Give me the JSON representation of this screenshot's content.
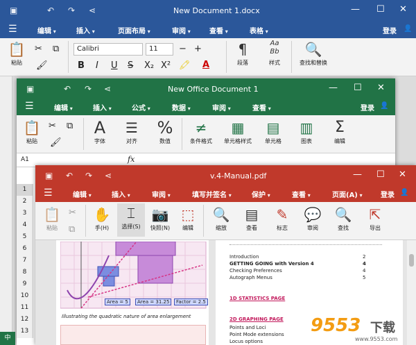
{
  "word": {
    "title": "New Document 1.docx",
    "menu": [
      "编辑",
      "插入",
      "页面布局",
      "审阅",
      "查看",
      "表格"
    ],
    "login": "登录",
    "ribbon": {
      "paste": "粘贴",
      "font": "Calibri",
      "size": "11",
      "minus": "−",
      "plus": "+",
      "bold": "B",
      "italic": "I",
      "underline": "U",
      "strike": "S",
      "sub": "X₂",
      "sup": "X²",
      "paragraph": "段落",
      "style_glyph": "Aa\nBb",
      "style": "样式",
      "find": "查找和替换"
    }
  },
  "excel": {
    "title": "New Office Document 1",
    "menu": [
      "编辑",
      "插入",
      "公式",
      "数据",
      "审阅",
      "查看"
    ],
    "login": "登录",
    "ribbon": [
      "粘贴",
      "字体",
      "对齐",
      "数值",
      "条件格式",
      "单元格样式",
      "单元格",
      "图表",
      "编辑"
    ],
    "cell_ref": "A1",
    "fx": "fx",
    "rows": [
      "1",
      "2",
      "3",
      "4",
      "5",
      "6",
      "7",
      "8",
      "9",
      "10",
      "11",
      "12",
      "13",
      "14",
      "15"
    ],
    "sheet_tab": "中"
  },
  "pdf": {
    "title": "v.4-Manual.pdf",
    "menu": [
      "编辑",
      "插入",
      "审阅",
      "填写并签名",
      "保护",
      "查看",
      "页面(A)"
    ],
    "login": "登录",
    "ribbon": [
      "粘贴",
      "",
      "手(H)",
      "选择(S)",
      "快照(N)",
      "编辑",
      "缩放",
      "查看",
      "标志",
      "审阅",
      "查找",
      "导出"
    ],
    "caption": "Illustrating the quadratic nature of area enlargement",
    "labels": {
      "area1": "Area = 5",
      "area2": "Area = 31.25",
      "factor": "Factor = 2.5"
    },
    "toc": [
      {
        "t": "Introduction",
        "p": "2",
        "b": false
      },
      {
        "t": "GETTING GOING with Version 4",
        "p": "4",
        "b": true
      },
      {
        "t": "Checking Preferences",
        "p": "4",
        "b": false
      },
      {
        "t": "Autograph Menus",
        "p": "5",
        "b": false
      }
    ],
    "link1": "1D STATISTICS PAGE",
    "link2": "2D GRAPHING PAGE",
    "toc2": [
      "Points and Loci",
      "Point Mode extensions",
      "Locus options"
    ]
  },
  "watermark": {
    "main": "9553",
    "sub": "下载",
    "url": "www.9553.com"
  },
  "colors": {
    "word": "#2b579a",
    "excel": "#217346",
    "pdf": "#c0392b"
  }
}
